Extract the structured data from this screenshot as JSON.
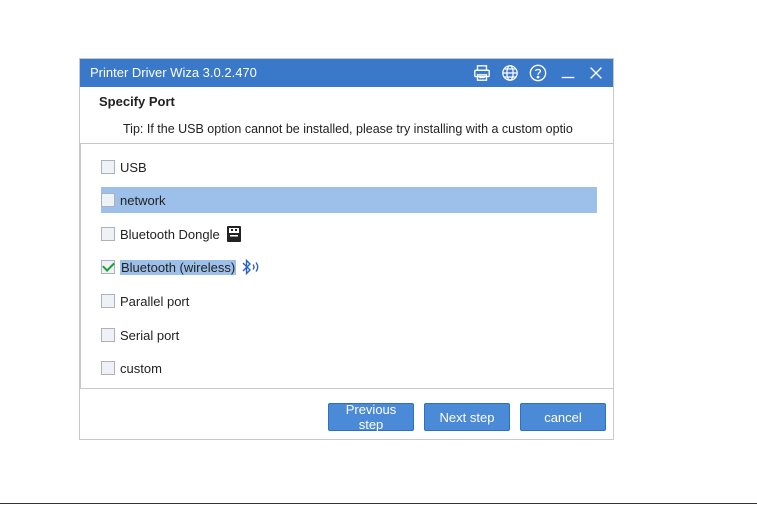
{
  "window": {
    "title": "Printer Driver Wiza  3.0.2.470",
    "icons": [
      "printer-icon",
      "globe-icon",
      "help-icon",
      "minimize-icon",
      "close-icon"
    ],
    "accent_color": "#3a78c9"
  },
  "page": {
    "section_title": "Specify Port",
    "tip": "Tip: If the USB option cannot be installed, please try installing with a custom optio"
  },
  "options": [
    {
      "label": "USB",
      "checked": false
    },
    {
      "label": "network",
      "checked": false,
      "highlighted": true
    },
    {
      "label": "Bluetooth Dongle",
      "checked": false,
      "icon": "usb-dongle-icon"
    },
    {
      "label": "Bluetooth (wireless)",
      "checked": true,
      "icon": "bluetooth-icon"
    },
    {
      "label": "Parallel port",
      "checked": false
    },
    {
      "label": "Serial port",
      "checked": false
    },
    {
      "label": "custom",
      "checked": false
    }
  ],
  "buttons": {
    "previous": "Previous step",
    "next": "Next step",
    "cancel": "cancel"
  }
}
